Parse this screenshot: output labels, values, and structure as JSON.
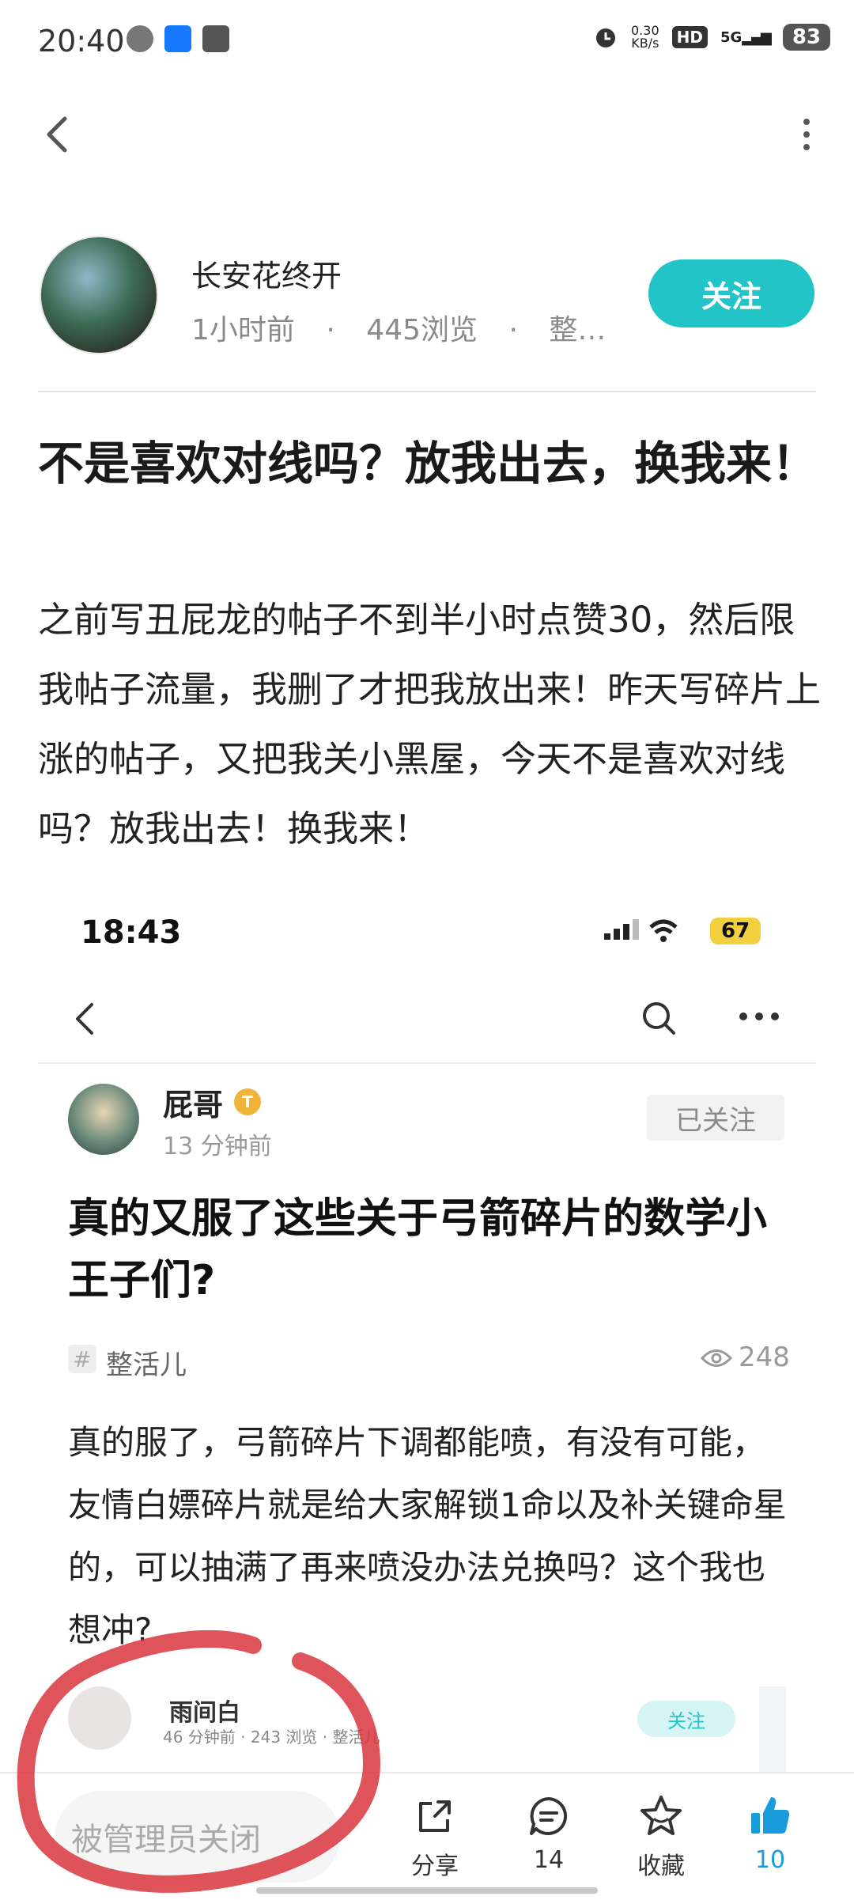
{
  "status_bar": {
    "time": "20:40",
    "net_speed_top": "0.30",
    "net_speed_unit": "KB/s",
    "hd": "HD",
    "signal": "5G",
    "battery": "83"
  },
  "nav": {
    "back_icon": "chevron-left-icon",
    "more_icon": "more-vertical-icon"
  },
  "author": {
    "name": "长安花终开",
    "time": "1小时前",
    "views": "445浏览",
    "category": "整…",
    "follow_label": "关注"
  },
  "post": {
    "title": "不是喜欢对线吗？放我出去，换我来！",
    "body": "之前写丑屁龙的帖子不到半小时点赞30，然后限我帖子流量，我删了才把我放出来！昨天写碎片上涨的帖子，又把我关小黑屋，今天不是喜欢对线吗？放我出去！换我来！"
  },
  "embedded": {
    "time": "18:43",
    "battery": "67",
    "author_name": "屁哥",
    "author_time": "13 分钟前",
    "followed_label": "已关注",
    "title": "真的又服了这些关于弓箭碎片的数学小王子们?",
    "tag_icon": "#",
    "tag": "整活儿",
    "views": "248",
    "body": "真的服了，弓箭碎片下调都能喷，有没有可能，友情白嫖碎片就是给大家解锁1命以及补关键命星的，可以抽满了再来喷没办法兑换吗？这个我也想冲?",
    "rec_name": "雨间白",
    "rec_meta": "46 分钟前 · 243 浏览 · 整活儿",
    "rec_follow": "关注"
  },
  "bottom": {
    "comment_placeholder": "被管理员关闭",
    "share_label": "分享",
    "comment_count": "14",
    "collect_label": "收藏",
    "like_count": "10"
  },
  "colors": {
    "accent": "#22c4c7",
    "like_blue": "#1a9bdc",
    "annotation_red": "#d9363e"
  }
}
